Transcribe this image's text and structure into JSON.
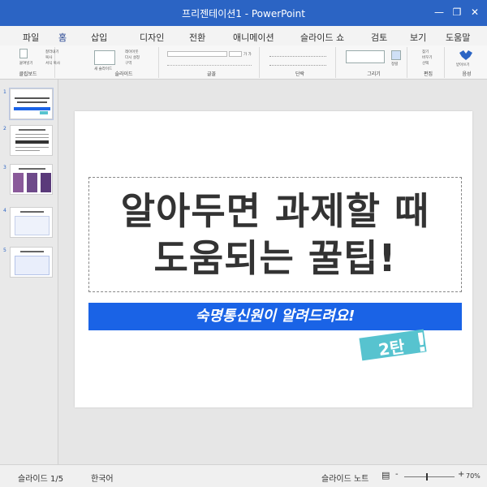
{
  "window": {
    "title": "프리젠테이션1 - PowerPoint"
  },
  "tabs": [
    "파일",
    "홈",
    "삽입",
    "디자인",
    "전환",
    "애니메이션",
    "슬라이드 쇼",
    "검토",
    "보기",
    "도움말"
  ],
  "ribbon": {
    "groups": [
      "클립보드",
      "슬라이드",
      "글꼴",
      "단락",
      "그리기",
      "편집",
      "음성"
    ],
    "clipboard": {
      "paste": "붙여넣기",
      "items": [
        "잘라내기",
        "복사",
        "서식 복사"
      ]
    },
    "slides": {
      "new_slide": "새 슬라이드",
      "items": [
        "레이아웃",
        "다시 설정",
        "구역"
      ]
    },
    "font": {
      "size": "가 가"
    },
    "drawing": {
      "arrange": "정렬"
    },
    "editing": {
      "items": [
        "찾기",
        "바꾸기",
        "선택"
      ]
    },
    "voice": {
      "dictate": "받아쓰기"
    }
  },
  "thumbnails": [
    "1",
    "2",
    "3",
    "4",
    "5"
  ],
  "slide": {
    "title_line1": "알아두면 과제할 때",
    "title_line2": "도움되는 꿀팁!",
    "subtitle": "숙명통신원이 알려드려요!",
    "badge": "2탄",
    "badge_excl": "!"
  },
  "status": {
    "slide_counter": "슬라이드 1/5",
    "language": "한국어",
    "notes": "슬라이드 노트",
    "zoom": "70%"
  },
  "colors": {
    "titlebar": "#2b64c4",
    "banner": "#1a63e6",
    "badge": "#57c3cf"
  }
}
